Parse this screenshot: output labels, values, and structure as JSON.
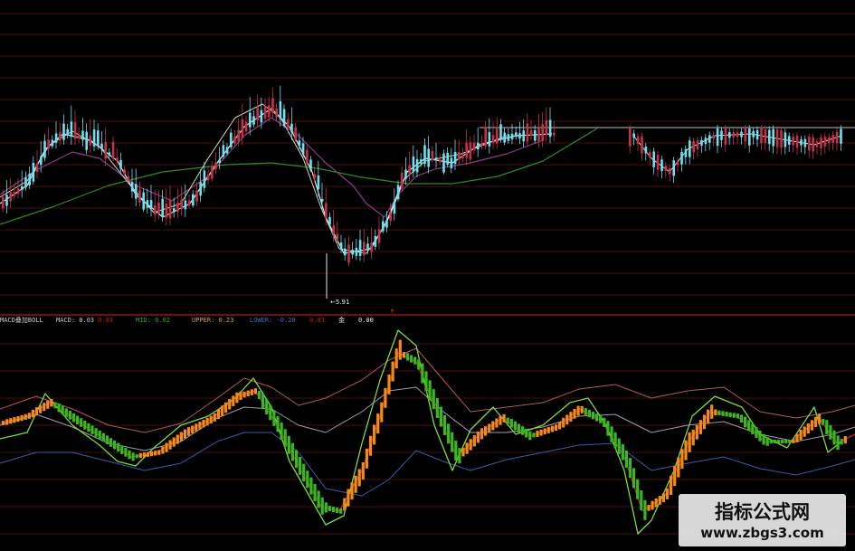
{
  "colors": {
    "background": "#000000",
    "grid": "#4a0d0d",
    "divider": "#9a1212",
    "candle_up": "#c4324a",
    "candle_down": "#6fe0f0",
    "ma_white": "#e8e8e8",
    "ma_purple": "#8a3d86",
    "ma_green": "#2f8a1f",
    "boll_upper": "#b0585a",
    "boll_mid": "#9a9ab0",
    "boll_lower": "#3d5aa8",
    "macd_line_green": "#7edc3a",
    "macd_line_red": "#c42020",
    "bar_orange": "#f28a18",
    "bar_green": "#38b81f"
  },
  "price_panel": {
    "low_label": "5.91"
  },
  "indicator_header": {
    "segments": [
      {
        "text": "MACD叠加BOLL",
        "color": "#c8c8c8"
      },
      {
        "text": "MACD: 0.03",
        "color": "#c8c8c8"
      },
      {
        "text": "0.03",
        "color": "#c42020"
      },
      {
        "text": "MID: 0.02",
        "color": "#2ea52e"
      },
      {
        "text": "UPPER: 0.23",
        "color": "#c8a83c"
      },
      {
        "text": "LOWER: -0.20",
        "color": "#4a6ac8"
      },
      {
        "text": "0.03",
        "color": "#c42020"
      },
      {
        "text": "金",
        "color": "#e8e8e8"
      },
      {
        "text": "0.00",
        "color": "#e8e8e8"
      }
    ]
  },
  "watermark": {
    "title": "指标公式网",
    "url": "www.zbgs3.com"
  }
}
